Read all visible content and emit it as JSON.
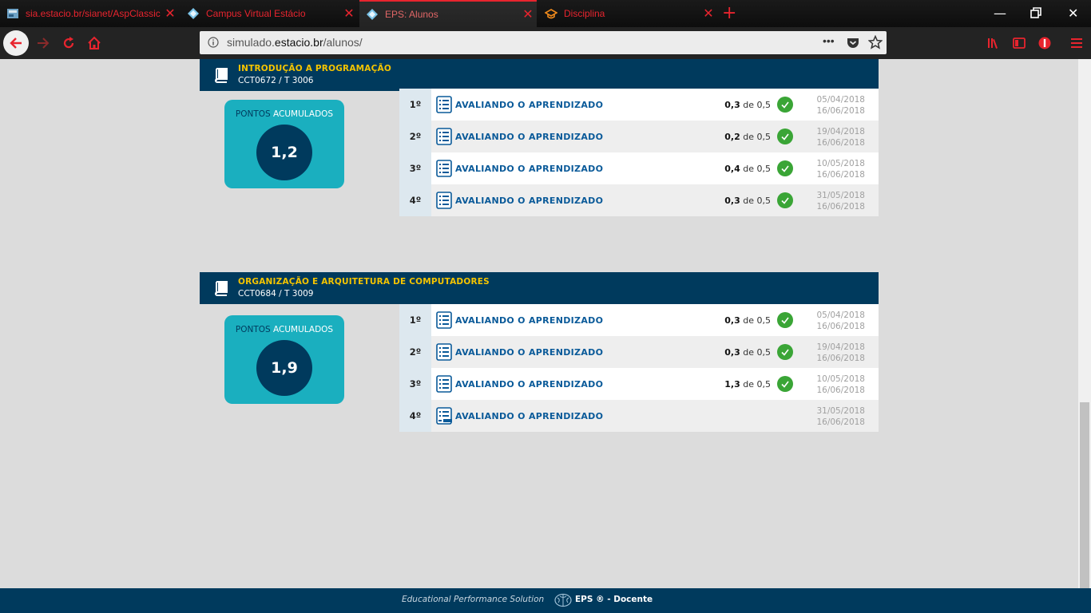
{
  "browser": {
    "tabs": [
      {
        "title": "sia.estacio.br/sianet/AspClassic",
        "icon": "site-thumbnail-icon"
      },
      {
        "title": "Campus Virtual Estácio",
        "icon": "diamond-icon"
      },
      {
        "title": "EPS: Alunos",
        "icon": "diamond-icon"
      },
      {
        "title": "Disciplina",
        "icon": "graduation-cap-icon"
      }
    ],
    "url_prefix": "simulado.",
    "url_host": "estacio.br",
    "url_path": "/alunos/",
    "url_more": "•••",
    "accent": "#e8242e"
  },
  "courses": [
    {
      "title": "INTRODUÇÃO A PROGRAMAÇÃO",
      "code": "CCT0672 / T 3006",
      "points_label_1": "PONTOS",
      "points_label_2": "ACUMULADOS",
      "points_value": "1,2",
      "activities": [
        {
          "num": "1º",
          "name": "AVALIANDO O APRENDIZADO",
          "score": "0,3",
          "of": "de",
          "max": "0,5",
          "done": true,
          "date1": "05/04/2018",
          "date2": "16/06/2018"
        },
        {
          "num": "2º",
          "name": "AVALIANDO O APRENDIZADO",
          "score": "0,2",
          "of": "de",
          "max": "0,5",
          "done": true,
          "date1": "19/04/2018",
          "date2": "16/06/2018"
        },
        {
          "num": "3º",
          "name": "AVALIANDO O APRENDIZADO",
          "score": "0,4",
          "of": "de",
          "max": "0,5",
          "done": true,
          "date1": "10/05/2018",
          "date2": "16/06/2018"
        },
        {
          "num": "4º",
          "name": "AVALIANDO O APRENDIZADO",
          "score": "0,3",
          "of": "de",
          "max": "0,5",
          "done": true,
          "date1": "31/05/2018",
          "date2": "16/06/2018"
        }
      ]
    },
    {
      "title": "ORGANIZAÇÃO E ARQUITETURA DE COMPUTADORES",
      "code": "CCT0684 / T 3009",
      "points_label_1": "PONTOS",
      "points_label_2": "ACUMULADOS",
      "points_value": "1,9",
      "activities": [
        {
          "num": "1º",
          "name": "AVALIANDO O APRENDIZADO",
          "score": "0,3",
          "of": "de",
          "max": "0,5",
          "done": true,
          "date1": "05/04/2018",
          "date2": "16/06/2018"
        },
        {
          "num": "2º",
          "name": "AVALIANDO O APRENDIZADO",
          "score": "0,3",
          "of": "de",
          "max": "0,5",
          "done": true,
          "date1": "19/04/2018",
          "date2": "16/06/2018"
        },
        {
          "num": "3º",
          "name": "AVALIANDO O APRENDIZADO",
          "score": "1,3",
          "of": "de",
          "max": "0,5",
          "done": true,
          "date1": "10/05/2018",
          "date2": "16/06/2018"
        },
        {
          "num": "4º",
          "name": "AVALIANDO O APRENDIZADO",
          "score": "",
          "of": "",
          "max": "",
          "done": false,
          "date1": "31/05/2018",
          "date2": "16/06/2018"
        }
      ]
    }
  ],
  "footer": {
    "tagline": "Educational Performance Solution",
    "brand": "EPS ® - Docente"
  },
  "colors": {
    "header_bg": "#003a5d",
    "title_yellow": "#f5c400",
    "points_bg": "#1aafbf",
    "check_green": "#3aa536",
    "link_blue": "#0a5a99"
  }
}
